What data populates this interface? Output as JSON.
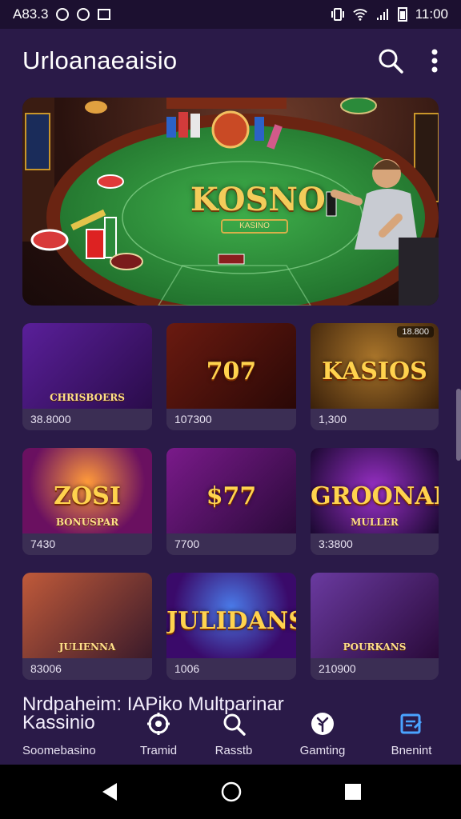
{
  "status_bar": {
    "left_text": "A83.3",
    "time": "11:00"
  },
  "app_bar": {
    "title": "Urloanaeaisio",
    "search_icon": "search-icon",
    "menu_icon": "more-vert-icon"
  },
  "hero": {
    "logo_text": "KOSNO",
    "sub_text": "KASINO"
  },
  "games": [
    {
      "title": "",
      "sub": "CHRISBOERS",
      "footer": "38.8000",
      "badge": "",
      "art": "lion"
    },
    {
      "title": "707",
      "sub": "",
      "footer": "107300",
      "badge": "",
      "art": "slot-gold"
    },
    {
      "title": "KASIOS",
      "sub": "",
      "footer": "1,300",
      "badge": "18.800",
      "art": "kasios"
    },
    {
      "title": "ZOSI",
      "sub": "BONUSPAR",
      "footer": "7430",
      "badge": "",
      "art": "zosi"
    },
    {
      "title": "$77",
      "sub": "",
      "footer": "7700",
      "badge": "",
      "art": "slot-red"
    },
    {
      "title": "GROONAK",
      "sub": "MULLER",
      "footer": "3:3800",
      "badge": "",
      "art": "groonak"
    },
    {
      "title": "",
      "sub": "JULIENNA",
      "footer": "83006",
      "badge": "",
      "art": "crowd"
    },
    {
      "title": "JULIDANS",
      "sub": "",
      "footer": "1006",
      "badge": "",
      "art": "julidans"
    },
    {
      "title": "",
      "sub": "POURKANS",
      "footer": "210900",
      "badge": "",
      "art": "pokers"
    }
  ],
  "promo": {
    "line1": "Nrdpaheim: IAPiko Multparinar",
    "line2": "Kassinio"
  },
  "bottom_nav": [
    {
      "label": "Soomebasino",
      "icon": ""
    },
    {
      "label": "Tramid",
      "icon": "chip-icon"
    },
    {
      "label": "Rasstb",
      "icon": "search-icon"
    },
    {
      "label": "Gamting",
      "icon": "sprout-icon"
    },
    {
      "label": "Bnenint",
      "icon": "edit-icon"
    }
  ],
  "colors": {
    "background": "#2a1a48",
    "card_footer": "#3b2e54",
    "felt_green": "#2d8a3a",
    "gold": "#f4cc5a"
  }
}
